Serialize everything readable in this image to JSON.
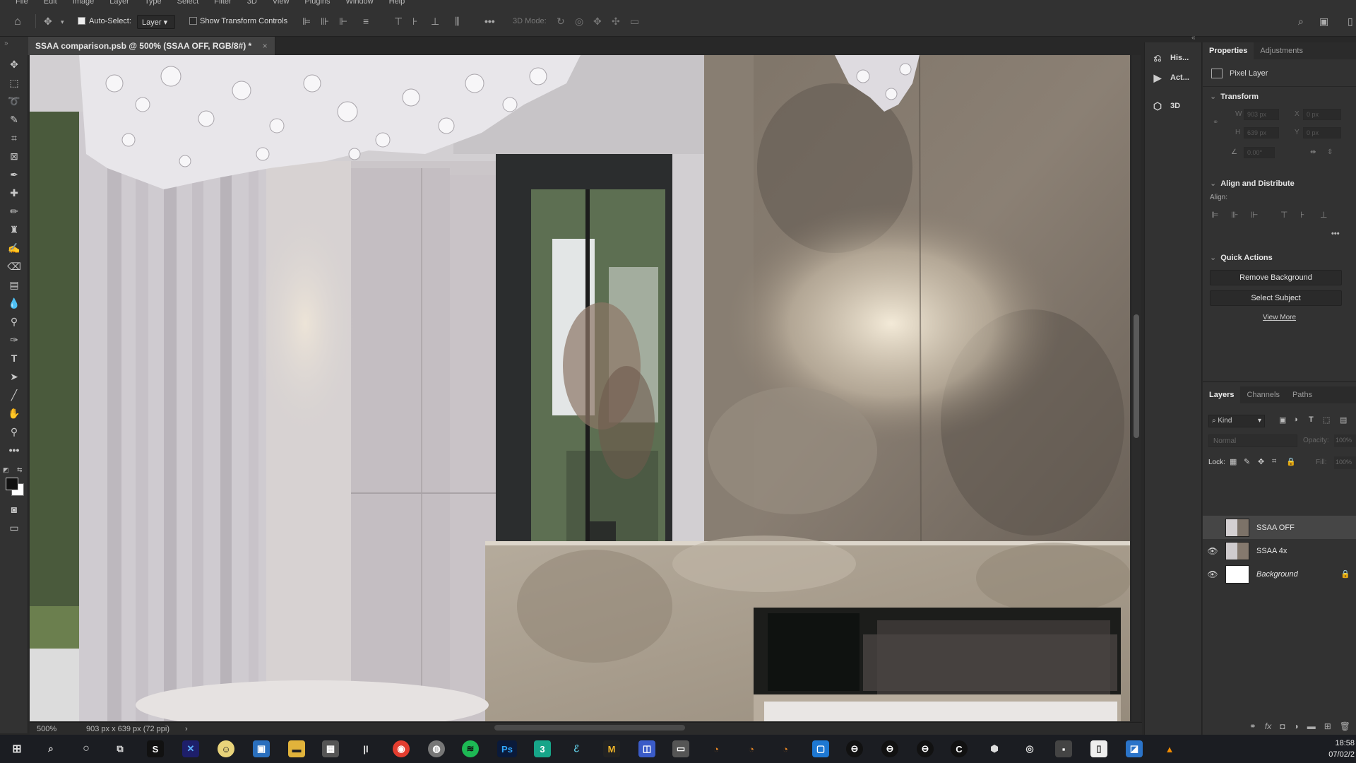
{
  "menu": [
    "File",
    "Edit",
    "Image",
    "Layer",
    "Type",
    "Select",
    "Filter",
    "3D",
    "View",
    "Plugins",
    "Window",
    "Help"
  ],
  "options": {
    "auto_select_label": "Auto-Select:",
    "layer_select": "Layer",
    "show_transform_label": "Show Transform Controls",
    "mode_3d_label": "3D Mode:"
  },
  "document": {
    "tab_title": "SSAA comparison.psb @ 500% (SSAA OFF, RGB/8#) *",
    "tab_close": "×"
  },
  "status": {
    "zoom": "500%",
    "doc_info": "903 px x 639 px (72 ppi)",
    "arrow": "›"
  },
  "mini_panels": [
    {
      "icon": "history-icon",
      "label": "His..."
    },
    {
      "icon": "actions-icon",
      "label": "Act..."
    },
    {
      "icon": "3d-icon",
      "label": "3D"
    }
  ],
  "properties": {
    "tabs": [
      "Properties",
      "Adjustments"
    ],
    "layer_type": "Pixel Layer",
    "transform_title": "Transform",
    "w_label": "W",
    "h_label": "H",
    "x_label": "X",
    "y_label": "Y",
    "w_value": "903 px",
    "h_value": "639 px",
    "x_value": "0 px",
    "y_value": "0 px",
    "angle_value": "0.00°",
    "align_title": "Align and Distribute",
    "align_label": "Align:",
    "quick_actions_title": "Quick Actions",
    "remove_bg": "Remove Background",
    "select_subject": "Select Subject",
    "view_more": "View More"
  },
  "layers_panel": {
    "tabs": [
      "Layers",
      "Channels",
      "Paths"
    ],
    "filter_kind": "Kind",
    "blend_mode": "Normal",
    "opacity_label": "Opacity:",
    "opacity_value": "100%",
    "lock_label": "Lock:",
    "fill_label": "Fill:",
    "fill_value": "100%",
    "layers": [
      {
        "name": "SSAA OFF",
        "visible": false,
        "selected": true,
        "italic": false
      },
      {
        "name": "SSAA 4x",
        "visible": true,
        "selected": false,
        "italic": false
      },
      {
        "name": "Background",
        "visible": true,
        "selected": false,
        "italic": true,
        "locked": true
      }
    ]
  },
  "taskbar": {
    "time": "18:58",
    "date": "07/02/2"
  }
}
